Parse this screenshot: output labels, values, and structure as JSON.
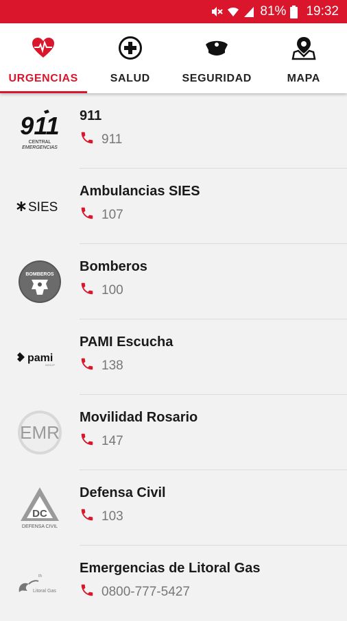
{
  "status_bar": {
    "battery_percent": "81%",
    "time": "19:32",
    "icons": [
      "mute-icon",
      "wifi-icon",
      "signal-icon",
      "battery-icon"
    ],
    "background_color": "#d9162b"
  },
  "tabs": [
    {
      "label": "URGENCIAS",
      "icon": "heart-pulse-icon",
      "active": true
    },
    {
      "label": "SALUD",
      "icon": "medical-cross-icon",
      "active": false
    },
    {
      "label": "SEGURIDAD",
      "icon": "police-cap-icon",
      "active": false
    },
    {
      "label": "MAPA",
      "icon": "map-pin-icon",
      "active": false
    }
  ],
  "accent_color": "#d9162b",
  "contacts": [
    {
      "name": "911",
      "phone": "911",
      "logo": "911-central-emergencias-logo",
      "logo_text": [
        "911",
        "CENTRAL",
        "EMERGENCIAS"
      ]
    },
    {
      "name": "Ambulancias SIES",
      "phone": "107",
      "logo": "sies-logo",
      "logo_text": [
        "SIES"
      ]
    },
    {
      "name": "Bomberos",
      "phone": "100",
      "logo": "bomberos-logo",
      "logo_text": [
        "BOMBEROS"
      ]
    },
    {
      "name": "PAMI Escucha",
      "phone": "138",
      "logo": "pami-logo",
      "logo_text": [
        "pami"
      ]
    },
    {
      "name": "Movilidad Rosario",
      "phone": "147",
      "logo": "emr-logo",
      "logo_text": [
        "EMR"
      ]
    },
    {
      "name": "Defensa Civil",
      "phone": "103",
      "logo": "defensa-civil-logo",
      "logo_text": [
        "DC",
        "DEFENSA CIVIL"
      ]
    },
    {
      "name": "Emergencias de Litoral Gas",
      "phone": "0800-777-5427",
      "logo": "litoral-gas-logo",
      "logo_text": [
        "Litoral Gas"
      ]
    }
  ]
}
